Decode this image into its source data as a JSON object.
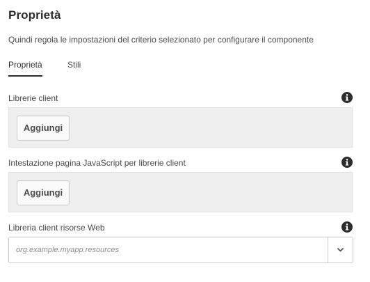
{
  "header": {
    "title": "Proprietà",
    "description": "Quindi regola le impostazioni del criterio selezionato per configurare il componente"
  },
  "tabs": [
    {
      "label": "Proprietà",
      "active": true
    },
    {
      "label": "Stili",
      "active": false
    }
  ],
  "fields": {
    "client_libs": {
      "label": "Librerie client",
      "add_label": "Aggiungi",
      "info_icon": "info-icon"
    },
    "client_libs_head": {
      "label": "Intestazione pagina JavaScript per librerie client",
      "add_label": "Aggiungi",
      "info_icon": "info-icon"
    },
    "web_resources": {
      "label": "Libreria client risorse Web",
      "placeholder": "org.example.myapp.resources",
      "info_icon": "info-icon",
      "toggle_icon": "chevron-down-icon"
    }
  },
  "colors": {
    "text": "#2c2c2c",
    "muted_text": "#4b4b4b",
    "field_background": "#efefef",
    "border": "#cacaca"
  }
}
